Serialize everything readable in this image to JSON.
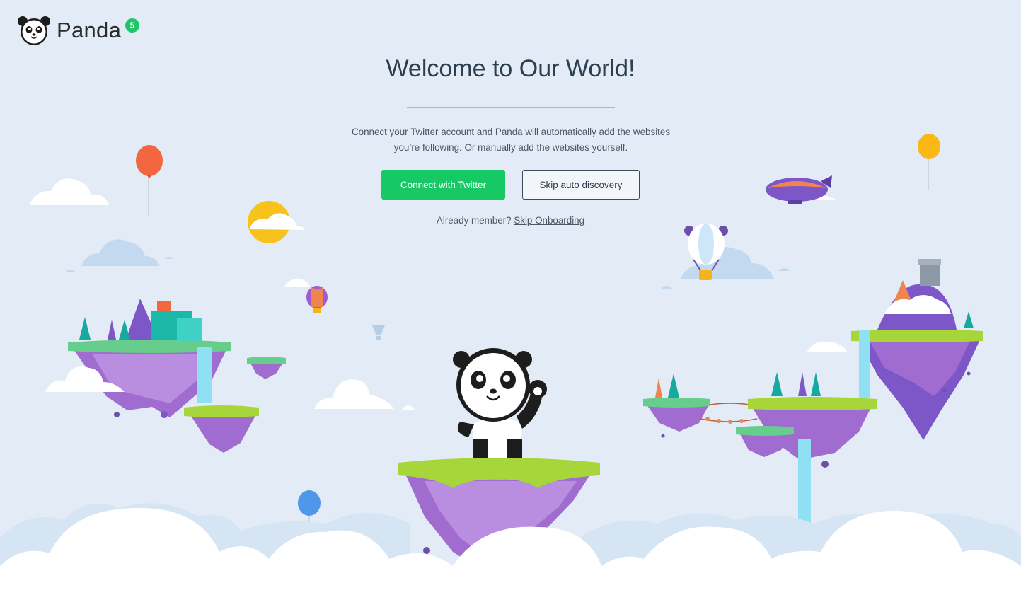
{
  "brand": {
    "name": "Panda",
    "badge": "5",
    "logo_icon": "panda-head-icon"
  },
  "onboarding": {
    "title": "Welcome to Our World!",
    "intro": "Connect your Twitter account and Panda will automatically add the websites you’re following. Or manually add the websites yourself.",
    "connect_button": "Connect with Twitter",
    "skip_button": "Skip auto discovery",
    "member_prompt": "Already member?",
    "skip_onboarding_link": "Skip Onboarding"
  },
  "colors": {
    "background": "#e3ecf6",
    "accent_green": "#17c964",
    "badge_green": "#21c569",
    "island_purple": "#a06bd0",
    "grass_green": "#a6d63a"
  }
}
